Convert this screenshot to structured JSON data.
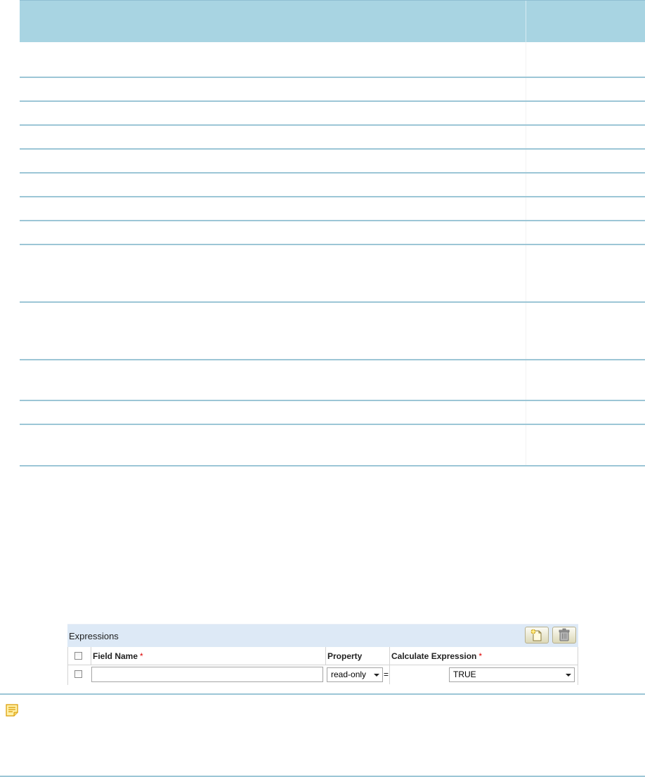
{
  "doc_table": {
    "row_count": 14
  },
  "expressions": {
    "title": "Expressions",
    "add_icon": "add-row-icon",
    "delete_icon": "trash-icon",
    "columns": {
      "field_name": "Field Name",
      "property": "Property",
      "calculate_expression": "Calculate Expression",
      "required_marker": "*"
    },
    "row": {
      "field_name_value": "",
      "property_value": "read-only",
      "equals": "=",
      "expression_value": "TRUE"
    }
  },
  "note": {
    "icon": "note-icon"
  },
  "colors": {
    "header_bg": "#a8d4e2",
    "row_rule": "#9cc6d6",
    "widget_title_bg": "#dde9f6",
    "required": "#dd0000",
    "note_icon": "#f2b417"
  }
}
